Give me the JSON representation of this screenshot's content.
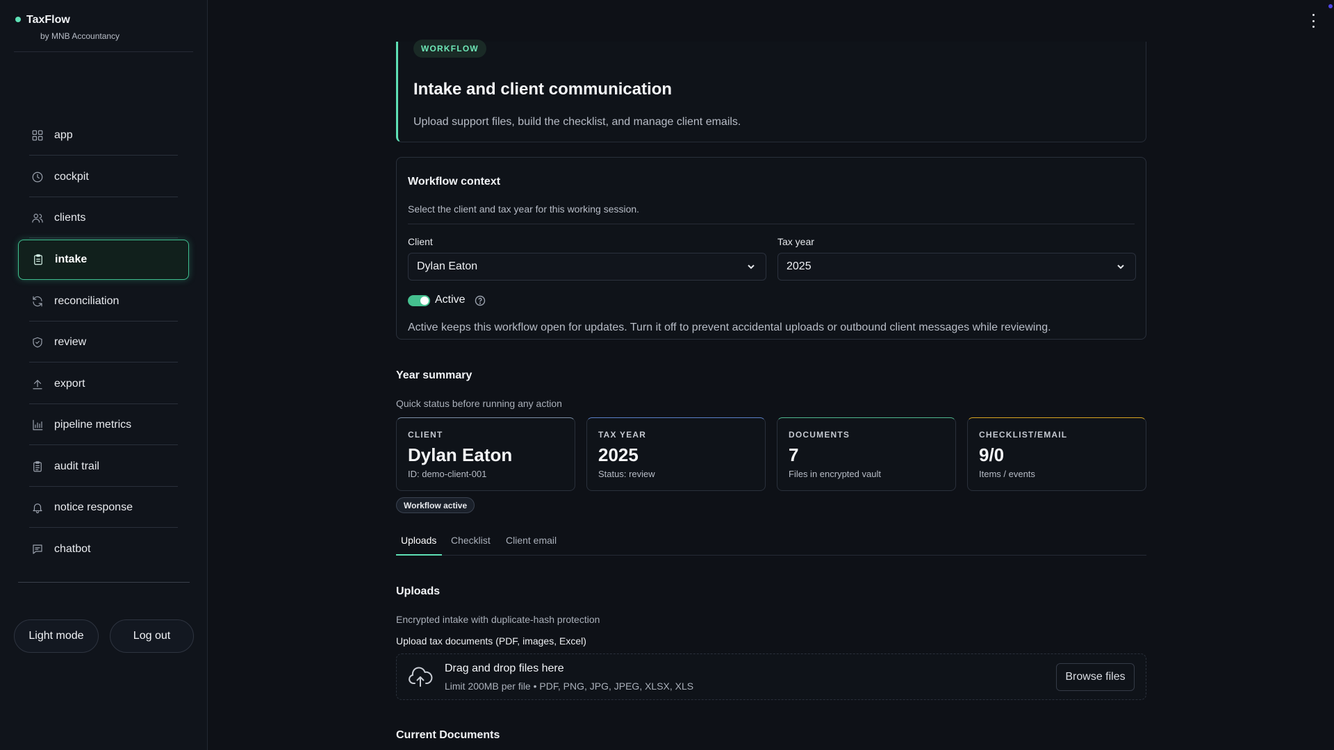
{
  "brand": {
    "title": "TaxFlow",
    "subtitle": "by MNB Accountancy"
  },
  "sidebar": {
    "items": [
      {
        "label": "app",
        "icon": "grid-icon"
      },
      {
        "label": "cockpit",
        "icon": "clock-icon"
      },
      {
        "label": "clients",
        "icon": "users-icon"
      },
      {
        "label": "intake",
        "icon": "clipboard-icon",
        "active": true
      },
      {
        "label": "reconciliation",
        "icon": "refresh-icon"
      },
      {
        "label": "review",
        "icon": "shield-check-icon"
      },
      {
        "label": "export",
        "icon": "upload-icon"
      },
      {
        "label": "pipeline metrics",
        "icon": "bar-chart-icon"
      },
      {
        "label": "audit trail",
        "icon": "clipboard-list-icon"
      },
      {
        "label": "notice response",
        "icon": "bell-icon"
      },
      {
        "label": "chatbot",
        "icon": "message-icon"
      }
    ],
    "light_mode": "Light mode",
    "log_out": "Log out"
  },
  "hero": {
    "badge": "WORKFLOW",
    "title": "Intake and client communication",
    "subtitle": "Upload support files, build the checklist, and manage client emails."
  },
  "context": {
    "title": "Workflow context",
    "subtitle": "Select the client and tax year for this working session.",
    "client_label": "Client",
    "client_value": "Dylan Eaton",
    "year_label": "Tax year",
    "year_value": "2025",
    "toggle_label": "Active",
    "toggle_on": true,
    "note": "Active keeps this workflow open for updates. Turn it off to prevent accidental uploads or outbound client messages while reviewing."
  },
  "summary": {
    "title": "Year summary",
    "subtitle": "Quick status before running any action",
    "metrics": [
      {
        "label": "CLIENT",
        "value": "Dylan Eaton",
        "sub": "ID: demo-client-001",
        "accent": "#7c8fa8"
      },
      {
        "label": "TAX YEAR",
        "value": "2025",
        "sub": "Status: review",
        "accent": "#5b7fc7"
      },
      {
        "label": "DOCUMENTS",
        "value": "7",
        "sub": "Files in encrypted vault",
        "accent": "#4fb88f"
      },
      {
        "label": "CHECKLIST/EMAIL",
        "value": "9/0",
        "sub": "Items / events",
        "accent": "#d9a520"
      }
    ],
    "status_chip": "Workflow active"
  },
  "tabs": [
    {
      "label": "Uploads",
      "active": true
    },
    {
      "label": "Checklist"
    },
    {
      "label": "Client email"
    }
  ],
  "uploads": {
    "title": "Uploads",
    "subtitle": "Encrypted intake with duplicate-hash protection",
    "field_label": "Upload tax documents (PDF, images, Excel)",
    "drop_title": "Drag and drop files here",
    "drop_sub": "Limit 200MB per file • PDF, PNG, JPG, JPEG, XLSX, XLS",
    "browse": "Browse files"
  },
  "current_docs": {
    "title": "Current Documents"
  },
  "colors": {
    "accent": "#5ee0b5",
    "toggle": "#45c08f",
    "background": "#0e1117"
  }
}
